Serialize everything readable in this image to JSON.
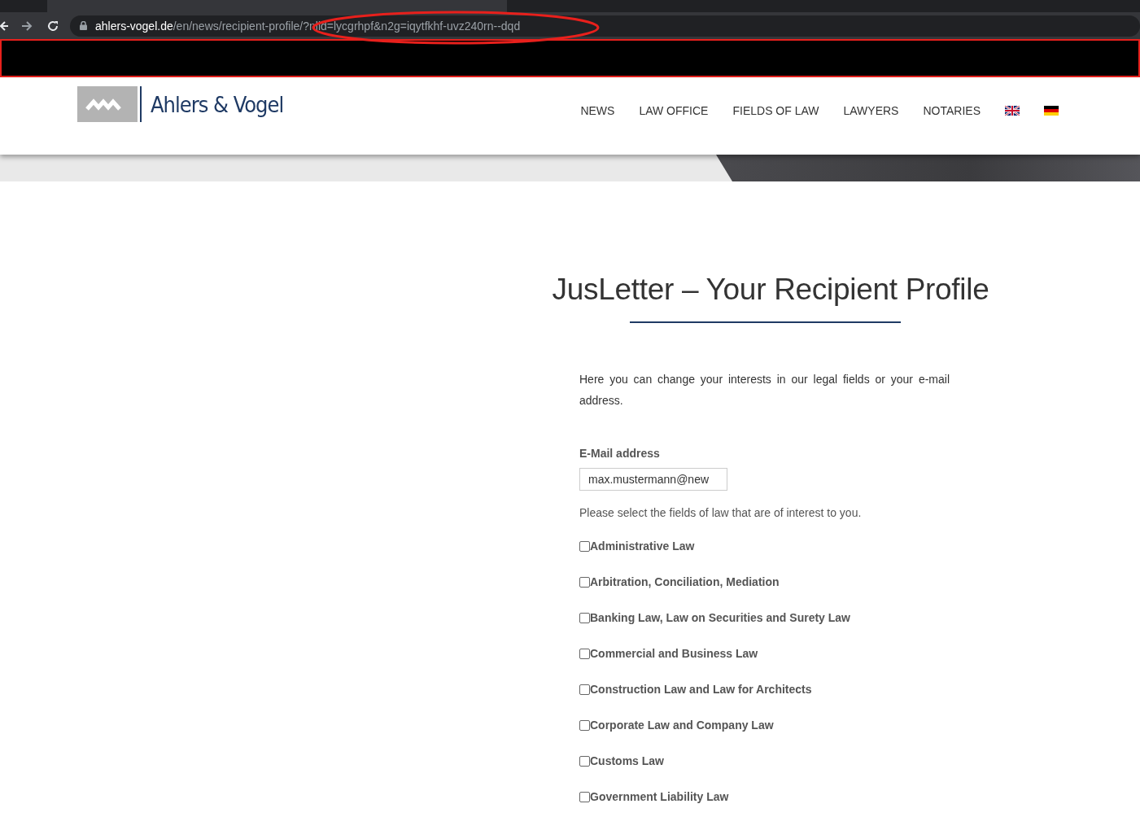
{
  "browser": {
    "address": {
      "host": "ahlers-vogel.de",
      "path": "/en/news/recipient-profile/?nlid=lycgrhpf&n2g=iqytfkhf-uvz240rn--dqd"
    }
  },
  "header": {
    "logo": {
      "name": "Ahlers & Vogel"
    },
    "nav": [
      {
        "label": "NEWS"
      },
      {
        "label": "LAW OFFICE"
      },
      {
        "label": "FIELDS OF LAW"
      },
      {
        "label": "LAWYERS"
      },
      {
        "label": "NOTARIES"
      }
    ],
    "languages": [
      {
        "kind": "uk"
      },
      {
        "kind": "de"
      }
    ]
  },
  "page": {
    "title": "JusLetter – Your Recipient Profile",
    "intro": "Here you can change your interests in our legal fields or your e-mail address.",
    "email": {
      "label": "E-Mail address",
      "value": "max.mustermann@new"
    },
    "fields_prompt": "Please select the fields of law that are of interest to you.",
    "fields": [
      {
        "label": "Administrative Law",
        "checked": false
      },
      {
        "label": "Arbitration, Conciliation, Mediation",
        "checked": false
      },
      {
        "label": "Banking Law, Law on Securities and Surety Law",
        "checked": false
      },
      {
        "label": "Commercial and Business Law",
        "checked": false
      },
      {
        "label": "Construction Law and Law for Architects",
        "checked": false
      },
      {
        "label": "Corporate Law and Company Law",
        "checked": false
      },
      {
        "label": "Customs Law",
        "checked": false
      },
      {
        "label": "Government Liability Law",
        "checked": false
      }
    ]
  }
}
